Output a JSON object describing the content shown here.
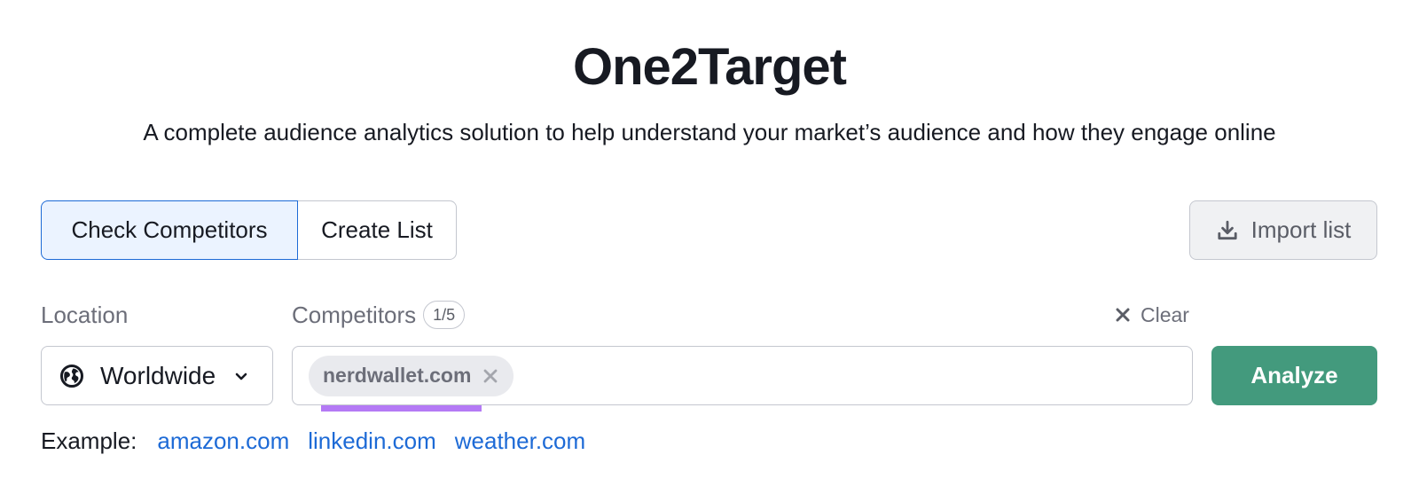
{
  "header": {
    "title": "One2Target",
    "subtitle": "A complete audience analytics solution to help understand your market’s audience and how they engage online"
  },
  "mode_tabs": [
    {
      "label": "Check Competitors",
      "selected": true
    },
    {
      "label": "Create List",
      "selected": false
    }
  ],
  "import_button": {
    "label": "Import list",
    "icon": "download-icon"
  },
  "location": {
    "label": "Location",
    "value": "Worldwide",
    "icon": "globe-icon"
  },
  "competitors": {
    "label": "Competitors",
    "count": "1/5",
    "chips": [
      {
        "label": "nerdwallet.com"
      }
    ],
    "clear_label": "Clear"
  },
  "analyze_button": {
    "label": "Analyze"
  },
  "examples": {
    "label": "Example:",
    "links": [
      "amazon.com",
      "linkedin.com",
      "weather.com"
    ]
  },
  "colors": {
    "accent_blue": "#1d6ad6",
    "analyze_green": "#439a7d",
    "highlight_purple": "#b47af5"
  }
}
